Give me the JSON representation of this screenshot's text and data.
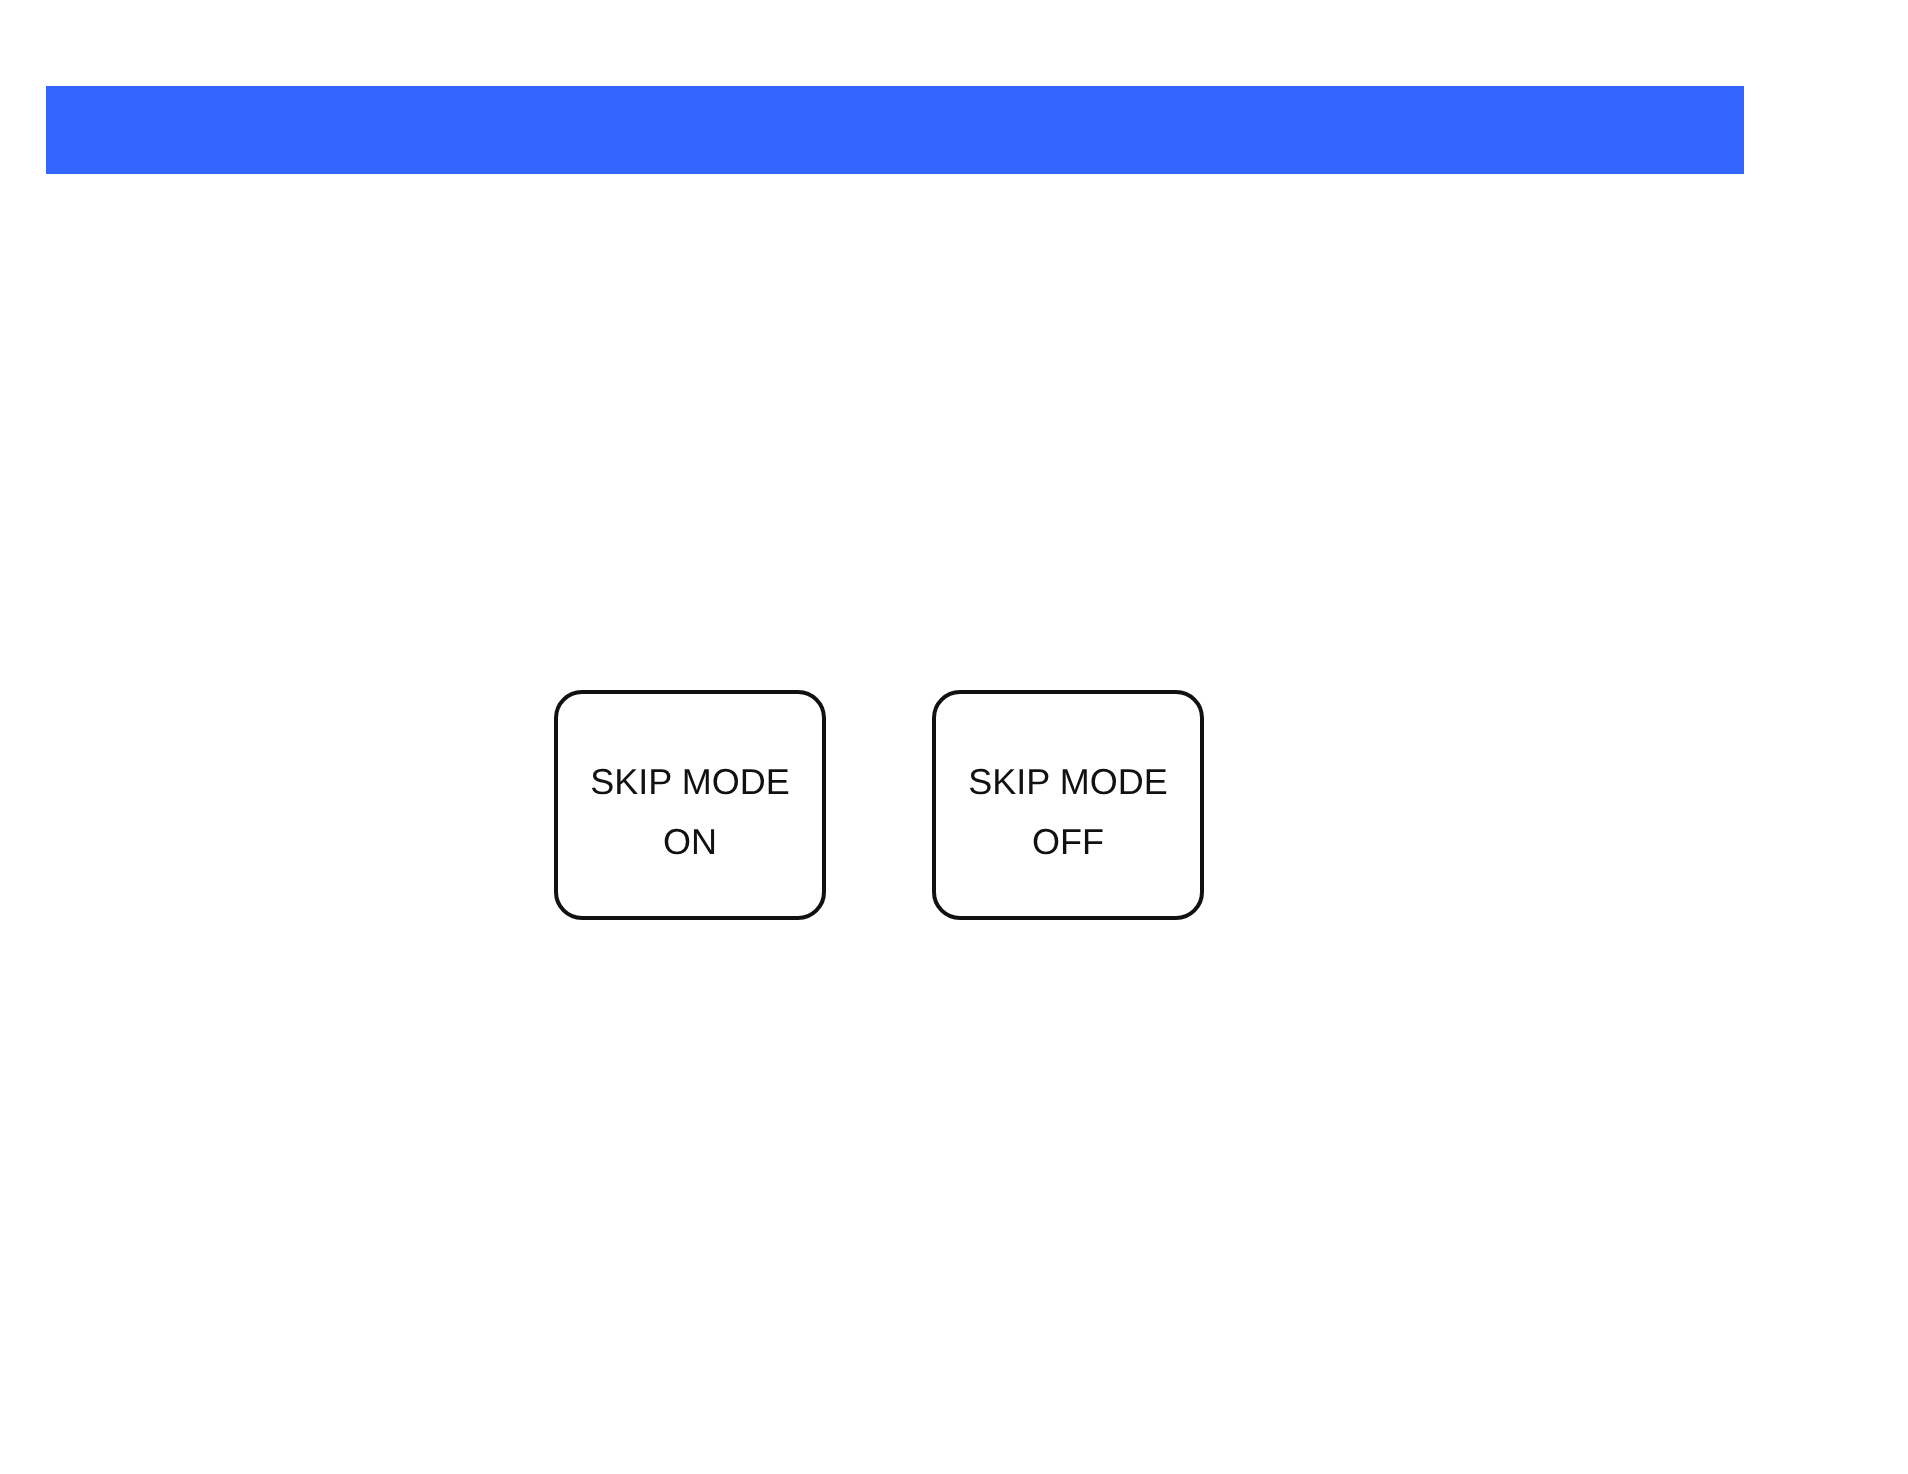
{
  "buttons": [
    {
      "label": "SKIP MODE ON"
    },
    {
      "label": "SKIP MODE OFF"
    }
  ]
}
